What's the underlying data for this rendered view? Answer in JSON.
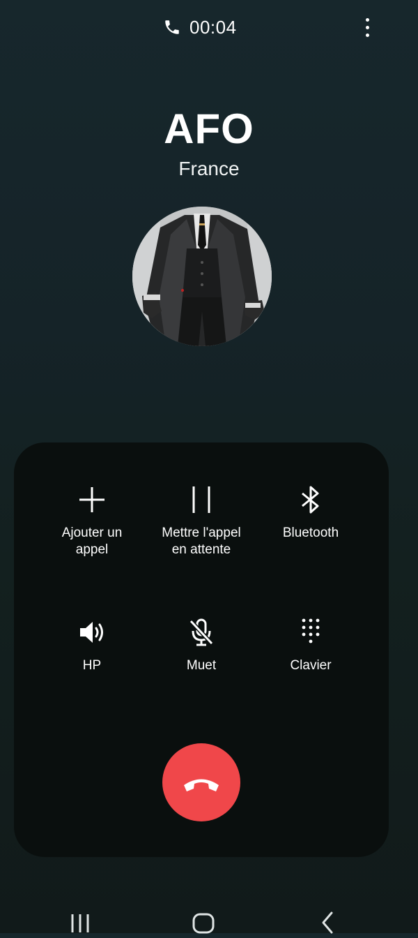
{
  "status": {
    "timer": "00:04",
    "phone_icon": "phone-icon",
    "menu_icon": "more-vertical-icon"
  },
  "contact": {
    "name": "AFO",
    "location": "France",
    "avatar": "contact-avatar"
  },
  "actions": [
    {
      "label": "Ajouter un\nappel",
      "icon": "plus-icon"
    },
    {
      "label": "Mettre l'appel\nen attente",
      "icon": "pause-icon"
    },
    {
      "label": "Bluetooth",
      "icon": "bluetooth-icon"
    },
    {
      "label": "HP",
      "icon": "speaker-icon"
    },
    {
      "label": "Muet",
      "icon": "mic-off-icon"
    },
    {
      "label": "Clavier",
      "icon": "keypad-icon"
    }
  ],
  "end_call": {
    "icon": "end-call-icon",
    "color": "#f0474a"
  },
  "navbar": {
    "recents_icon": "recents-icon",
    "home_icon": "home-icon",
    "back_icon": "back-icon"
  },
  "colors": {
    "panel_bg": "#0a0f0e",
    "end_call": "#f0474a"
  }
}
